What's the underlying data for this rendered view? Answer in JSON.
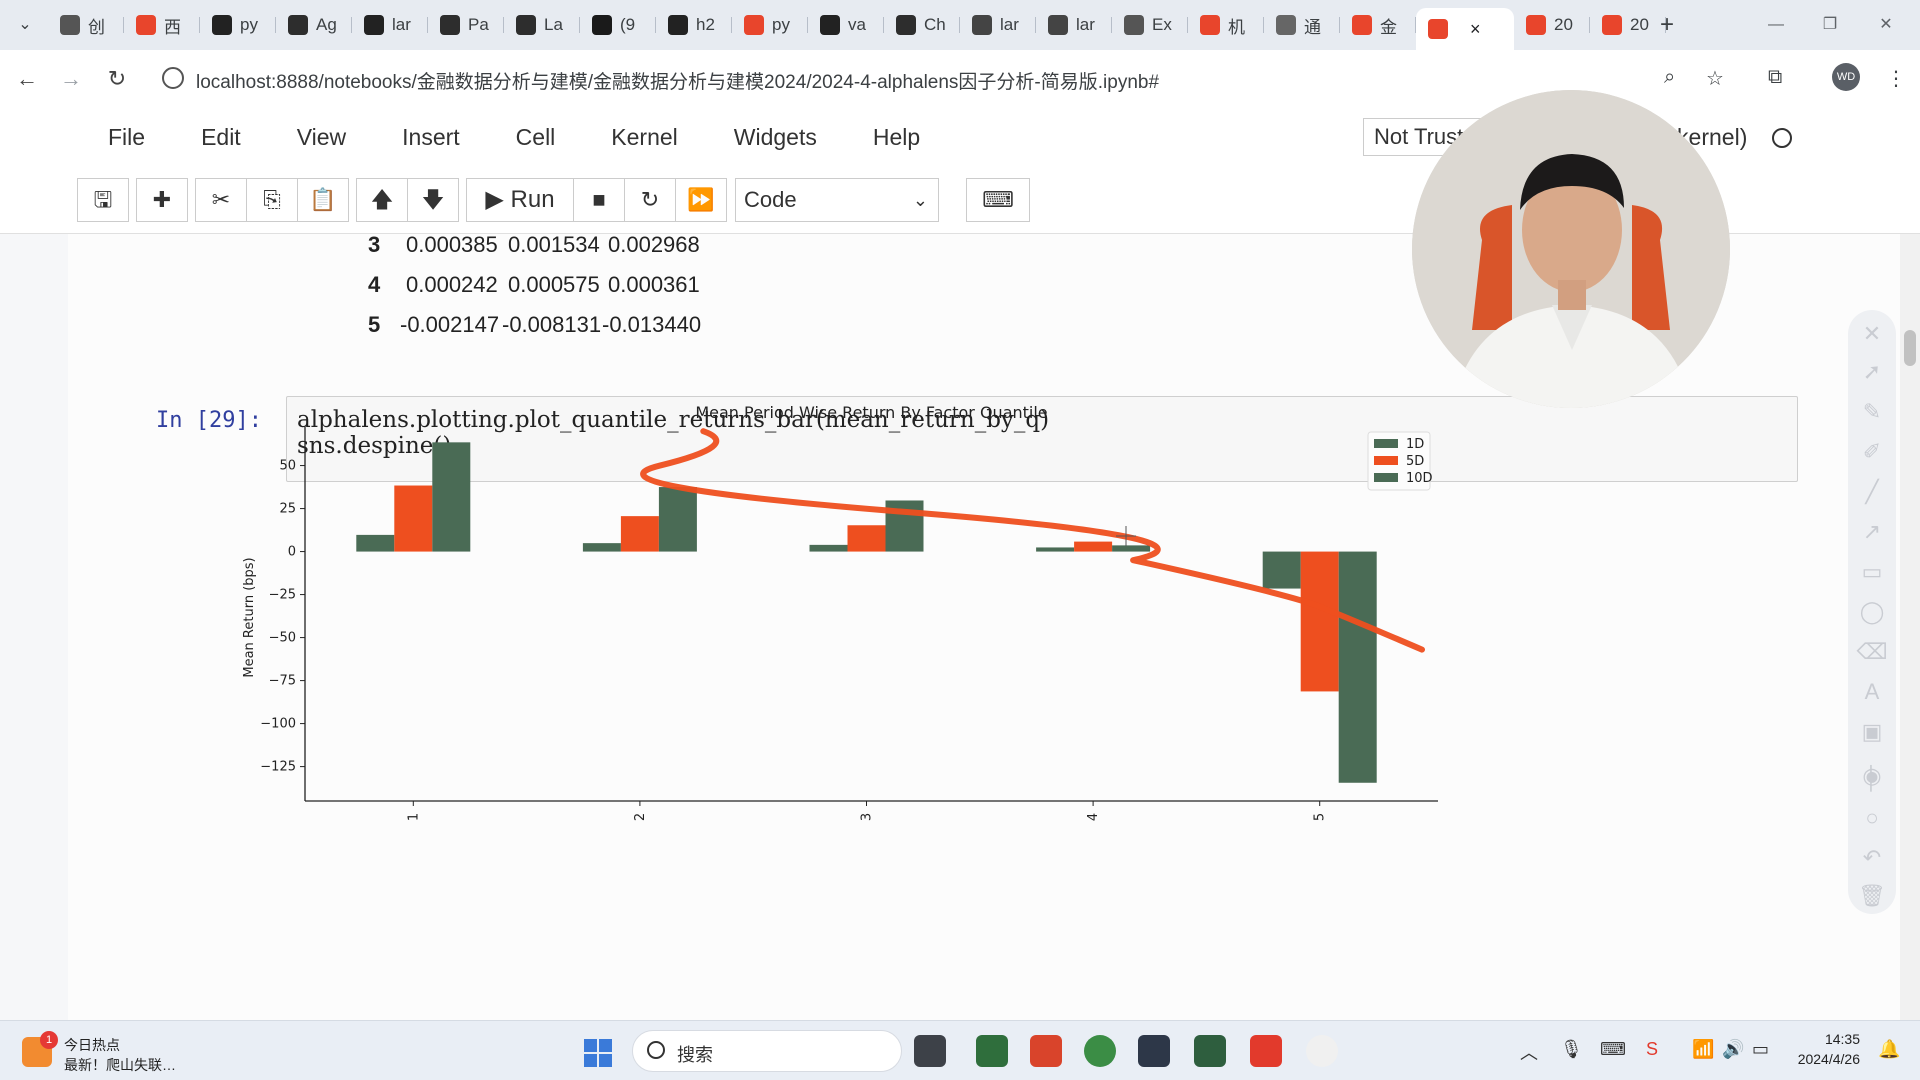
{
  "tabs": [
    {
      "label": "创",
      "color": "#555555"
    },
    {
      "label": "西",
      "color": "#e8452c"
    },
    {
      "label": "py",
      "color": "#222222"
    },
    {
      "label": "Ag",
      "color": "#2d2d2d"
    },
    {
      "label": "lar",
      "color": "#222222"
    },
    {
      "label": "Pa",
      "color": "#2d2d2d"
    },
    {
      "label": "La",
      "color": "#2d2d2d"
    },
    {
      "label": "(9",
      "color": "#1a1a1a"
    },
    {
      "label": "h2",
      "color": "#222222"
    },
    {
      "label": "py",
      "color": "#e8452c"
    },
    {
      "label": "va",
      "color": "#222222"
    },
    {
      "label": "Ch",
      "color": "#2d2d2d"
    },
    {
      "label": "lar",
      "color": "#444444"
    },
    {
      "label": "lar",
      "color": "#444444"
    },
    {
      "label": "Ex",
      "color": "#555555"
    },
    {
      "label": "机",
      "color": "#e8452c"
    },
    {
      "label": "通",
      "color": "#666666"
    },
    {
      "label": "金",
      "color": "#e8452c"
    }
  ],
  "active_tab": {
    "label": "",
    "close": "×",
    "color": "#e8452c"
  },
  "extra_tabs": [
    {
      "label": "20",
      "color": "#e8452c"
    },
    {
      "label": "20",
      "color": "#e8452c"
    }
  ],
  "new_tab": "+",
  "window": {
    "minimize": "—",
    "restore": "❐",
    "close": "✕"
  },
  "address": {
    "url": "localhost:8888/notebooks/金融数据分析与建模/金融数据分析与建模2024/2024-4-alphalens因子分析-简易版.ipynb#",
    "profile": "WD"
  },
  "jupyter": {
    "menu": [
      "File",
      "Edit",
      "View",
      "Insert",
      "Cell",
      "Kernel",
      "Widgets",
      "Help"
    ],
    "trust": "Not Trusted",
    "kernel": "(ipykernel)",
    "run_label": "Run",
    "cell_type": "Code"
  },
  "dataframe_rows": [
    {
      "index": "3",
      "values": [
        "0.000385",
        "0.001534",
        "0.002968"
      ]
    },
    {
      "index": "4",
      "values": [
        "0.000242",
        "0.000575",
        "0.000361"
      ]
    },
    {
      "index": "5",
      "values": [
        "-0.002147",
        "-0.008131",
        "-0.013440"
      ]
    }
  ],
  "cell": {
    "prompt": "In  [29]:",
    "code": [
      "alphalens.plotting.plot_quantile_returns_bar(mean_return_by_q)",
      "sns.despine()"
    ]
  },
  "chart_data": {
    "type": "bar",
    "title": "Mean Period Wise Return By Factor Quantile",
    "ylabel": "Mean Return (bps)",
    "xlabel": "",
    "categories": [
      "1",
      "2",
      "3",
      "4",
      "5"
    ],
    "series": [
      {
        "name": "1D",
        "color": "#4a6b55",
        "values": [
          9.7,
          4.9,
          3.9,
          2.4,
          -21.5
        ]
      },
      {
        "name": "5D",
        "color": "#ee4f1f",
        "values": [
          38.4,
          20.6,
          15.3,
          5.8,
          -81.3
        ]
      },
      {
        "name": "10D",
        "color": "#4a6b55",
        "values": [
          63.5,
          37.5,
          29.7,
          3.6,
          -134.4
        ]
      }
    ],
    "yticks": [
      50,
      25,
      0,
      -25,
      -50,
      -75,
      -100,
      -125
    ],
    "ylim": [
      -145,
      73
    ],
    "legend": "top-right",
    "annotation": {
      "type": "freehand-trend-line",
      "color": "#ee4f1f"
    }
  },
  "taskbar": {
    "news_badge": "1",
    "news_title": "今日热点",
    "news_sub": "最新！爬山失联…",
    "search": "搜索",
    "time": "14:35",
    "date": "2024/4/26"
  }
}
